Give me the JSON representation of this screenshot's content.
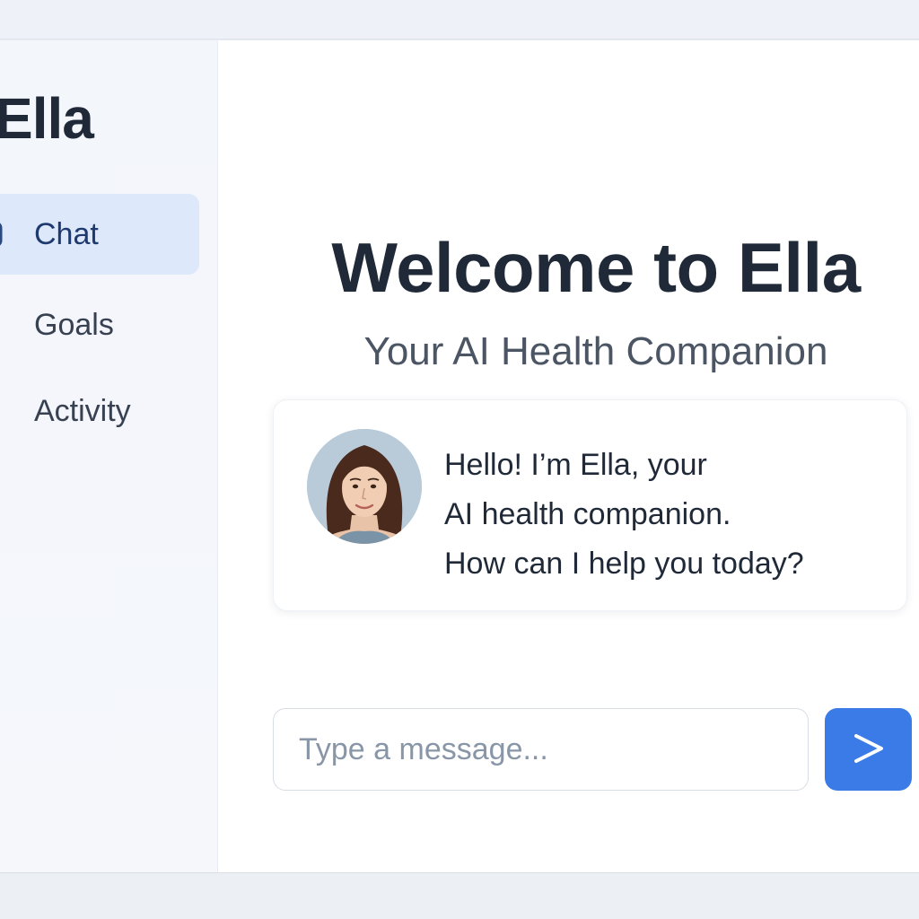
{
  "sidebar": {
    "brand": "Ella",
    "items": [
      {
        "label": "Chat",
        "icon": "chat-bubble-icon",
        "active": true
      },
      {
        "label": "Goals",
        "icon": "star-icon",
        "active": false
      },
      {
        "label": "Activity",
        "icon": "activity-bar-icon",
        "active": false
      }
    ]
  },
  "main": {
    "title": "Welcome to Ella",
    "subtitle": "Your AI Health Companion",
    "message": {
      "avatar": "assistant-avatar",
      "lines": [
        "Hello! I’m Ella, your",
        "AI health companion.",
        "How can I help you today?"
      ]
    },
    "composer": {
      "placeholder": "Type a message...",
      "value": "",
      "send_icon": "chevron-right-icon"
    }
  },
  "colors": {
    "accent": "#3b7be8",
    "active_nav_bg": "#dde8fb",
    "text_dark": "#1f2937",
    "text_muted": "#4b5563"
  }
}
